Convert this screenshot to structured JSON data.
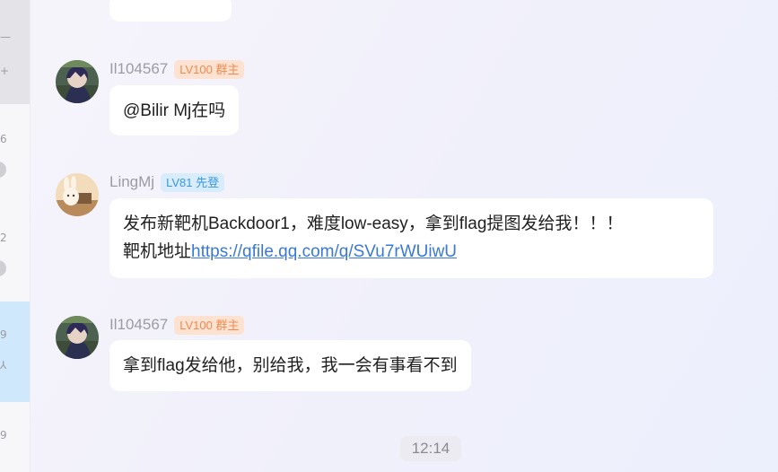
{
  "left_list": {
    "items": [
      {
        "line_a": "—",
        "line_b": "+"
      },
      {
        "num": "6"
      },
      {
        "num": "2"
      },
      {
        "line_a": "9",
        "line_b": "⅄"
      },
      {
        "num": "9"
      }
    ]
  },
  "messages": [
    {
      "sender": "Il104567",
      "badge": "LV100 群主",
      "text": "@Bilir Mj在吗"
    },
    {
      "sender": "LingMj",
      "badge": "LV81 先登",
      "text_line1": "发布新靶机Backdoor1，难度low-easy，拿到flag提图发给我！！！",
      "text_line2_prefix": "靶机地址",
      "link": "https://qfile.qq.com/q/SVu7rWUiwU"
    },
    {
      "sender": "Il104567",
      "badge": "LV100 群主",
      "text": "拿到flag发给他，别给我，我一会有事看不到"
    }
  ],
  "timestamp": "12:14",
  "colors": {
    "badge_owner_bg": "#fde2d2",
    "badge_owner_fg": "#f08a4e",
    "badge_member_bg": "#d8ecfb",
    "badge_member_fg": "#3a98e2",
    "link": "#3a78d6",
    "selected_chat": "#cfe8fb"
  }
}
